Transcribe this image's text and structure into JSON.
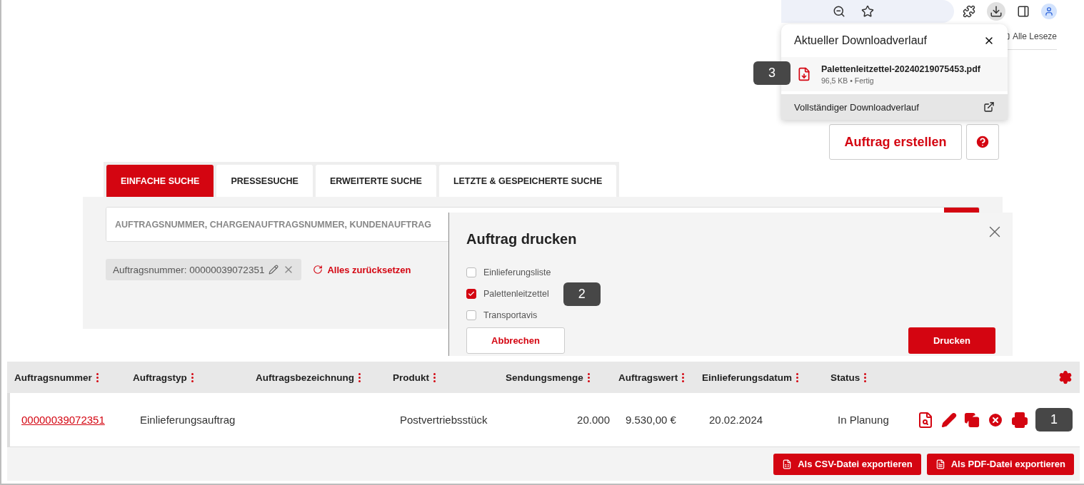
{
  "browser_toolbar": {
    "bookmarks_label": "Alle Leseze"
  },
  "download_popup": {
    "title": "Aktueller Downloadverlauf",
    "step_badge": "3",
    "items": [
      {
        "filename": "Palettenleitzettel-20240219075453.pdf",
        "meta": "96,5 KB • Fertig"
      }
    ],
    "footer_link": "Vollständiger Downloadverlauf"
  },
  "header_actions": {
    "create_button": "Auftrag erstellen"
  },
  "tabs": [
    {
      "label": "EINFACHE SUCHE",
      "selected": true
    },
    {
      "label": "PRESSESUCHE",
      "selected": false
    },
    {
      "label": "ERWEITERTE SUCHE",
      "selected": false
    },
    {
      "label": "LETZTE & GESPEICHERTE SUCHE",
      "selected": false
    }
  ],
  "search": {
    "placeholder": "AUFTRAGSNUMMER, CHARGENAUFTRAGSNUMMER, KUNDENAUFTRAG"
  },
  "filters": [
    {
      "label": "Auftragsnummer: 00000039072351"
    }
  ],
  "reset_label": "Alles zurücksetzen",
  "dialog": {
    "title": "Auftrag drucken",
    "options": [
      {
        "label": "Einlieferungsliste",
        "checked": false
      },
      {
        "label": "Palettenleitzettel",
        "checked": true,
        "step_badge": "2"
      },
      {
        "label": "Transportavis",
        "checked": false
      }
    ],
    "cancel": "Abbrechen",
    "confirm": "Drucken"
  },
  "table": {
    "columns": [
      "Auftragsnummer",
      "Auftragstyp",
      "Auftragsbezeichnung",
      "Produkt",
      "Sendungsmenge",
      "Auftragswert",
      "Einlieferungsdatum",
      "Status"
    ],
    "rows": [
      {
        "cells": [
          "00000039072351",
          "Einlieferungsauftrag",
          "",
          "Postvertriebsstück",
          "20.000",
          "9.530,00 €",
          "20.02.2024",
          "In Planung"
        ],
        "step_badge": "1"
      }
    ]
  },
  "export_buttons": [
    {
      "label": "Als CSV-Datei exportieren",
      "kind": "csv"
    },
    {
      "label": "Als PDF-Datei exportieren",
      "kind": "pdf"
    }
  ]
}
